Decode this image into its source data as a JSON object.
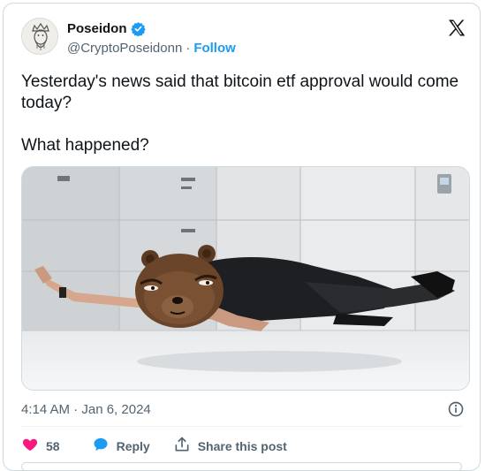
{
  "author": {
    "name": "Poseidon",
    "handle": "@CryptoPoseidonn",
    "separator": "·",
    "follow_label": "Follow"
  },
  "tweet": {
    "line1": "Yesterday's news said that bitcoin etf approval would come today?",
    "line2": "What happened?",
    "timestamp": "4:14 AM · Jan 6, 2024"
  },
  "actions": {
    "likes": "58",
    "reply_label": "Reply",
    "share_label": "Share this post"
  },
  "colors": {
    "accent": "#1d9bf0",
    "like": "#f91880",
    "muted": "#536471"
  },
  "icons": [
    "verified-badge-icon",
    "x-logo-icon",
    "info-icon",
    "heart-icon",
    "reply-bubble-icon",
    "share-icon"
  ]
}
